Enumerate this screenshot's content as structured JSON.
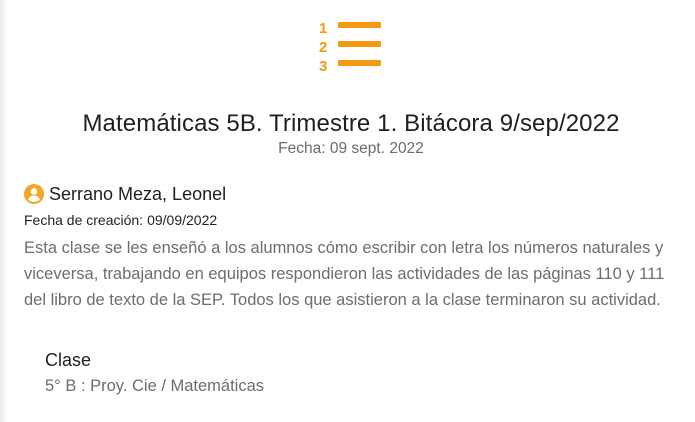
{
  "colors": {
    "accent": "#f59a0f",
    "title": "#1f1f1f",
    "muted": "#6d6d6d"
  },
  "header": {
    "icon": "numbered-list-icon",
    "title": "Matemáticas 5B. Trimestre 1. Bitácora 9/sep/2022",
    "date_label": "Fecha: 09 sept. 2022"
  },
  "entry": {
    "author_icon": "user-circle-icon",
    "author": "Serrano Meza, Leonel",
    "created_label": "Fecha de creación:",
    "created_value": "09/09/2022",
    "description": "Esta clase se les enseñó a los alumnos cómo escribir con letra los números naturales y viceversa, trabajando en equipos respondieron las actividades de las páginas 110 y 111 del libro de texto de la SEP. Todos los que asistieron a la clase terminaron su actividad."
  },
  "class_section": {
    "heading": "Clase",
    "value": "5° B : Proy. Cie / Matemáticas"
  }
}
